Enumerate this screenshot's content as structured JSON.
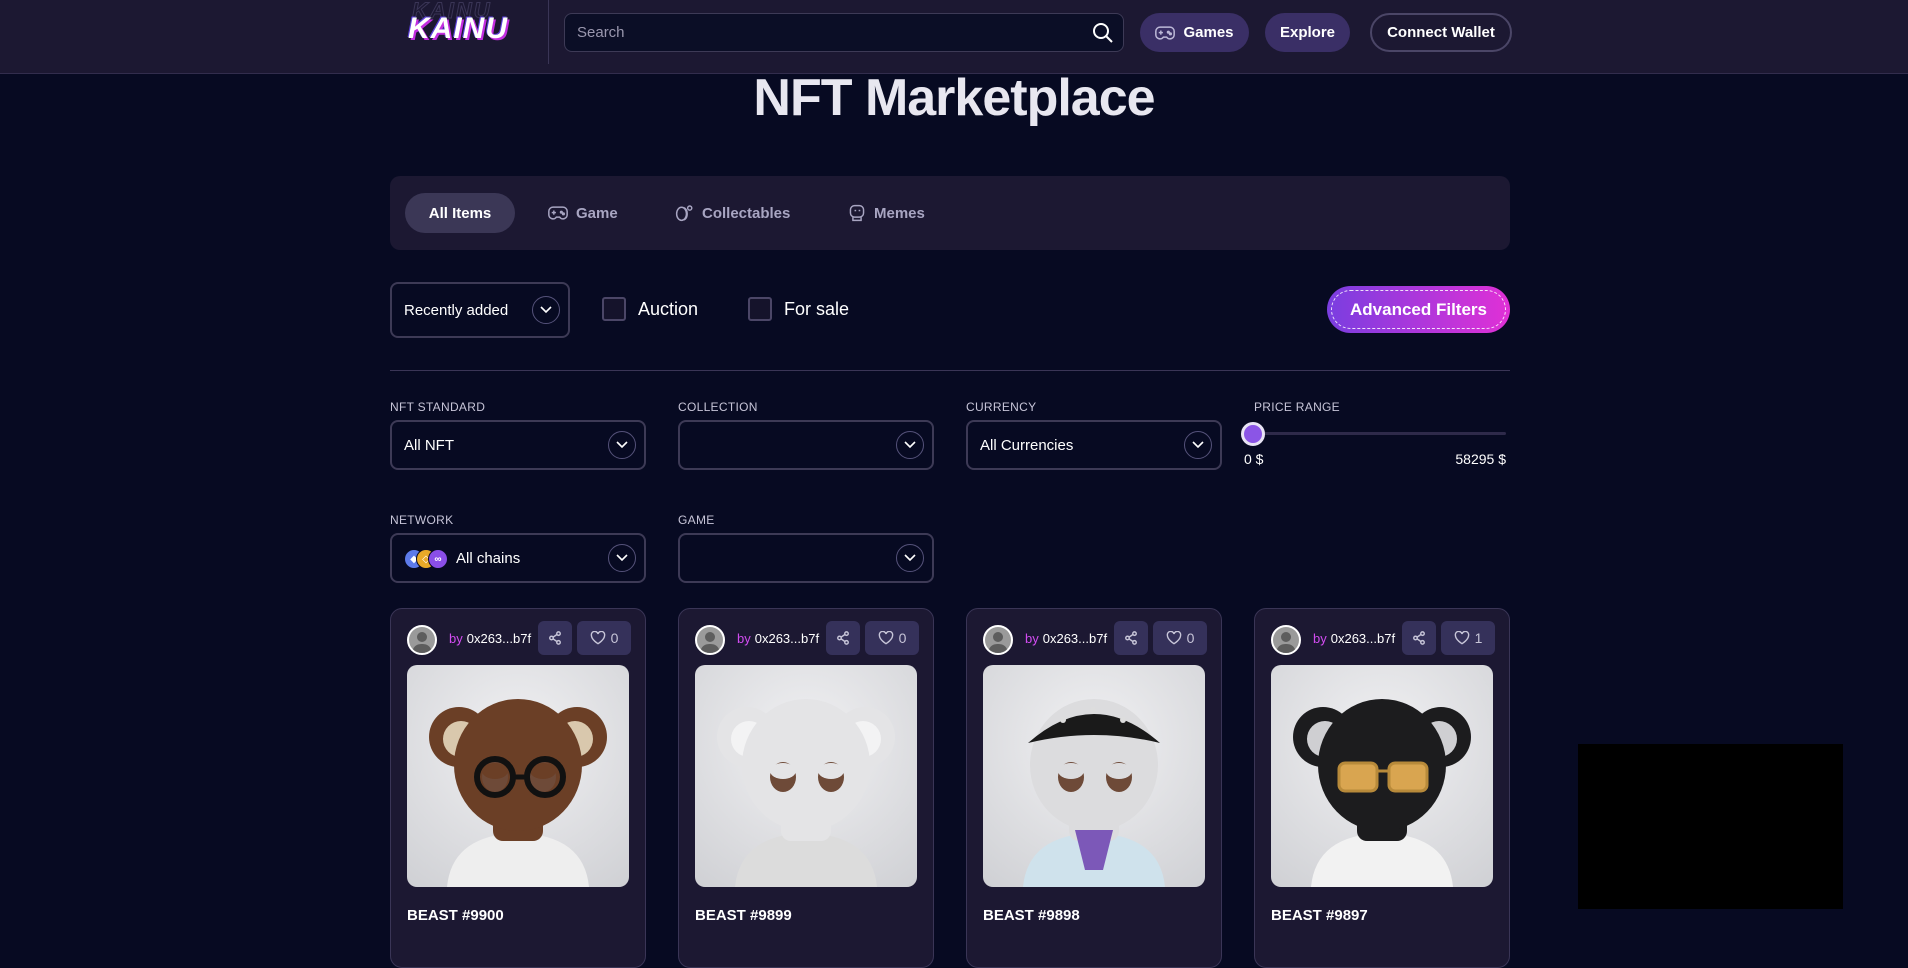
{
  "header": {
    "logo_text": "KAINU",
    "search_placeholder": "Search",
    "games_label": "Games",
    "explore_label": "Explore",
    "connect_wallet_label": "Connect Wallet"
  },
  "page": {
    "title": "NFT Marketplace"
  },
  "tabs": [
    {
      "label": "All Items",
      "active": true
    },
    {
      "label": "Game",
      "active": false
    },
    {
      "label": "Collectables",
      "active": false
    },
    {
      "label": "Memes",
      "active": false
    }
  ],
  "toolbar": {
    "sort_value": "Recently added",
    "auction_label": "Auction",
    "auction_checked": false,
    "for_sale_label": "For sale",
    "for_sale_checked": false,
    "advanced_filters_label": "Advanced Filters"
  },
  "filters": {
    "nft_standard": {
      "label": "NFT STANDARD",
      "value": "All NFT"
    },
    "collection": {
      "label": "COLLECTION",
      "value": ""
    },
    "currency": {
      "label": "CURRENCY",
      "value": "All Currencies"
    },
    "price_range": {
      "label": "PRICE RANGE",
      "min_label": "0 $",
      "max_label": "58295 $",
      "min": 0,
      "max": 58295,
      "value": 0
    },
    "network": {
      "label": "NETWORK",
      "value": "All chains"
    },
    "game": {
      "label": "GAME",
      "value": ""
    }
  },
  "cards": [
    {
      "by_word": "by",
      "owner": "0x263...b7f",
      "likes": "0",
      "name": "BEAST #9900",
      "mask": "#6b3f26",
      "ears": "#6b3f26",
      "ear_inner": "#d9c8ad",
      "glasses": "round-black",
      "shirt": "#eeeeee"
    },
    {
      "by_word": "by",
      "owner": "0x263...b7f",
      "likes": "0",
      "name": "BEAST #9899",
      "mask": "#e4e4e6",
      "ears": "#e4e4e6",
      "ear_inner": "#f3f3f4",
      "glasses": "none",
      "shirt": "#dcdcdc"
    },
    {
      "by_word": "by",
      "owner": "0x263...b7f",
      "likes": "0",
      "name": "BEAST #9898",
      "mask": "#dcdcde",
      "ears": "none",
      "ear_inner": "none",
      "glasses": "bandana",
      "shirt": "#cfe2ec"
    },
    {
      "by_word": "by",
      "owner": "0x263...b7f",
      "likes": "1",
      "name": "BEAST #9897",
      "mask": "#1c1c1e",
      "ears": "#1c1c1e",
      "ear_inner": "#cfcfd2",
      "glasses": "gold",
      "shirt": "#f2f2f2"
    }
  ],
  "colors": {
    "background": "#070a22",
    "panel": "#1c1832",
    "accent_purple": "#7a3ee0",
    "accent_pink": "#e030d6",
    "owner_by": "#d14cf0"
  }
}
